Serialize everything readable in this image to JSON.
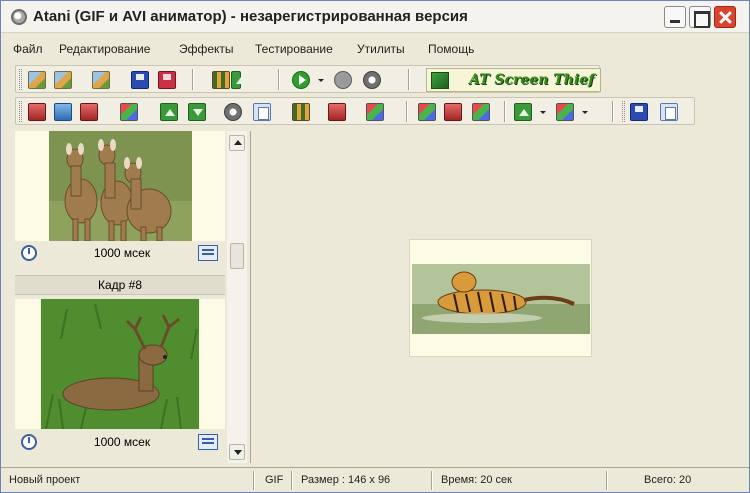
{
  "window": {
    "title": "Atani (GIF и AVI аниматор) - незарегистрированная версия"
  },
  "menu": [
    "Файл",
    "Редактирование",
    "Эффекты",
    "Тестирование",
    "Утилиты",
    "Помощь"
  ],
  "toolbar": {
    "screen_thief_label": "AT Screen Thief"
  },
  "frames": [
    {
      "delay": "1000 мсек",
      "image": "deer-herd"
    },
    {
      "header": "Кадр #8",
      "delay": "1000 мсек",
      "image": "deer-lying"
    }
  ],
  "preview": {
    "image": "tiger-in-water"
  },
  "status": {
    "project": "Новый проект",
    "format": "GIF",
    "size": "Размер : 146 x 96",
    "time": "Время: 20 сек",
    "total": "Всего: 20"
  },
  "colors": {
    "title_bar": "#f4f3ee",
    "window_bg": "#ece9d8",
    "close_button": "#d9432f",
    "frame_bg": "#fbfbe6"
  }
}
